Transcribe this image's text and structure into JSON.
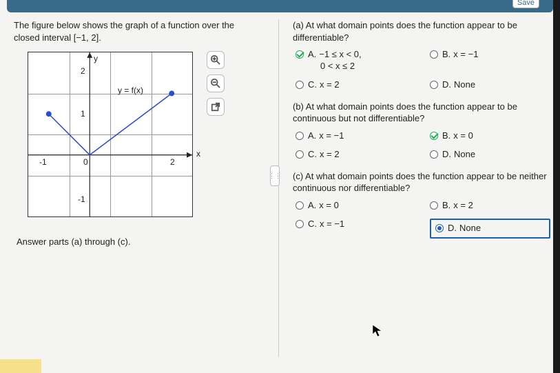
{
  "header": {
    "save_label": "Save"
  },
  "stem": {
    "text": "The figure below shows the graph of a function over the closed interval [−1, 2].",
    "y_axis": "y",
    "x_axis": "x",
    "fn_label": "y = f(x)",
    "ticks": {
      "y_top": "2",
      "y_mid": "1",
      "x_left": "-1",
      "x_origin": "0",
      "x_right": "2",
      "y_btm": "-1"
    },
    "instruction": "Answer parts (a) through (c)."
  },
  "tools": {
    "zoom_in": "zoom-in",
    "zoom_out": "zoom-out",
    "popout": "popout"
  },
  "parts": {
    "a": {
      "prompt": "(a) At what domain points does the function appear to be differentiable?",
      "choices": [
        {
          "letter": "A.",
          "text_line1": "−1 ≤ x < 0,",
          "text_line2": "0 < x ≤ 2",
          "state": "checked"
        },
        {
          "letter": "B.",
          "text_line1": "x = −1",
          "state": ""
        },
        {
          "letter": "C.",
          "text_line1": "x = 2",
          "state": ""
        },
        {
          "letter": "D.",
          "text_line1": "None",
          "state": ""
        }
      ]
    },
    "b": {
      "prompt": "(b) At what domain points does the function appear to be continuous but not differentiable?",
      "choices": [
        {
          "letter": "A.",
          "text_line1": "x = −1",
          "state": ""
        },
        {
          "letter": "B.",
          "text_line1": "x = 0",
          "state": "checked"
        },
        {
          "letter": "C.",
          "text_line1": "x = 2",
          "state": ""
        },
        {
          "letter": "D.",
          "text_line1": "None",
          "state": ""
        }
      ]
    },
    "c": {
      "prompt": "(c) At what domain points does the function appear to be neither continuous nor differentiable?",
      "choices": [
        {
          "letter": "A.",
          "text_line1": "x = 0",
          "state": ""
        },
        {
          "letter": "B.",
          "text_line1": "x = 2",
          "state": ""
        },
        {
          "letter": "C.",
          "text_line1": "x = −1",
          "state": ""
        },
        {
          "letter": "D.",
          "text_line1": "None",
          "state": "dot",
          "boxed": true
        }
      ]
    }
  },
  "chart_data": {
    "type": "line",
    "title": "y = f(x) on [-1, 2]",
    "xlabel": "x",
    "ylabel": "y",
    "xlim": [
      -1.5,
      2.5
    ],
    "ylim": [
      -1.5,
      2.5
    ],
    "series": [
      {
        "name": "f(x)",
        "points": [
          [
            -1,
            1
          ],
          [
            0,
            0
          ],
          [
            2,
            1.5
          ]
        ],
        "closed_endpoints": [
          [
            -1,
            1
          ],
          [
            2,
            1.5
          ]
        ]
      }
    ],
    "gridlines": {
      "x": [
        -1,
        0,
        1,
        2
      ],
      "y": [
        -1,
        0,
        1,
        2
      ]
    }
  }
}
